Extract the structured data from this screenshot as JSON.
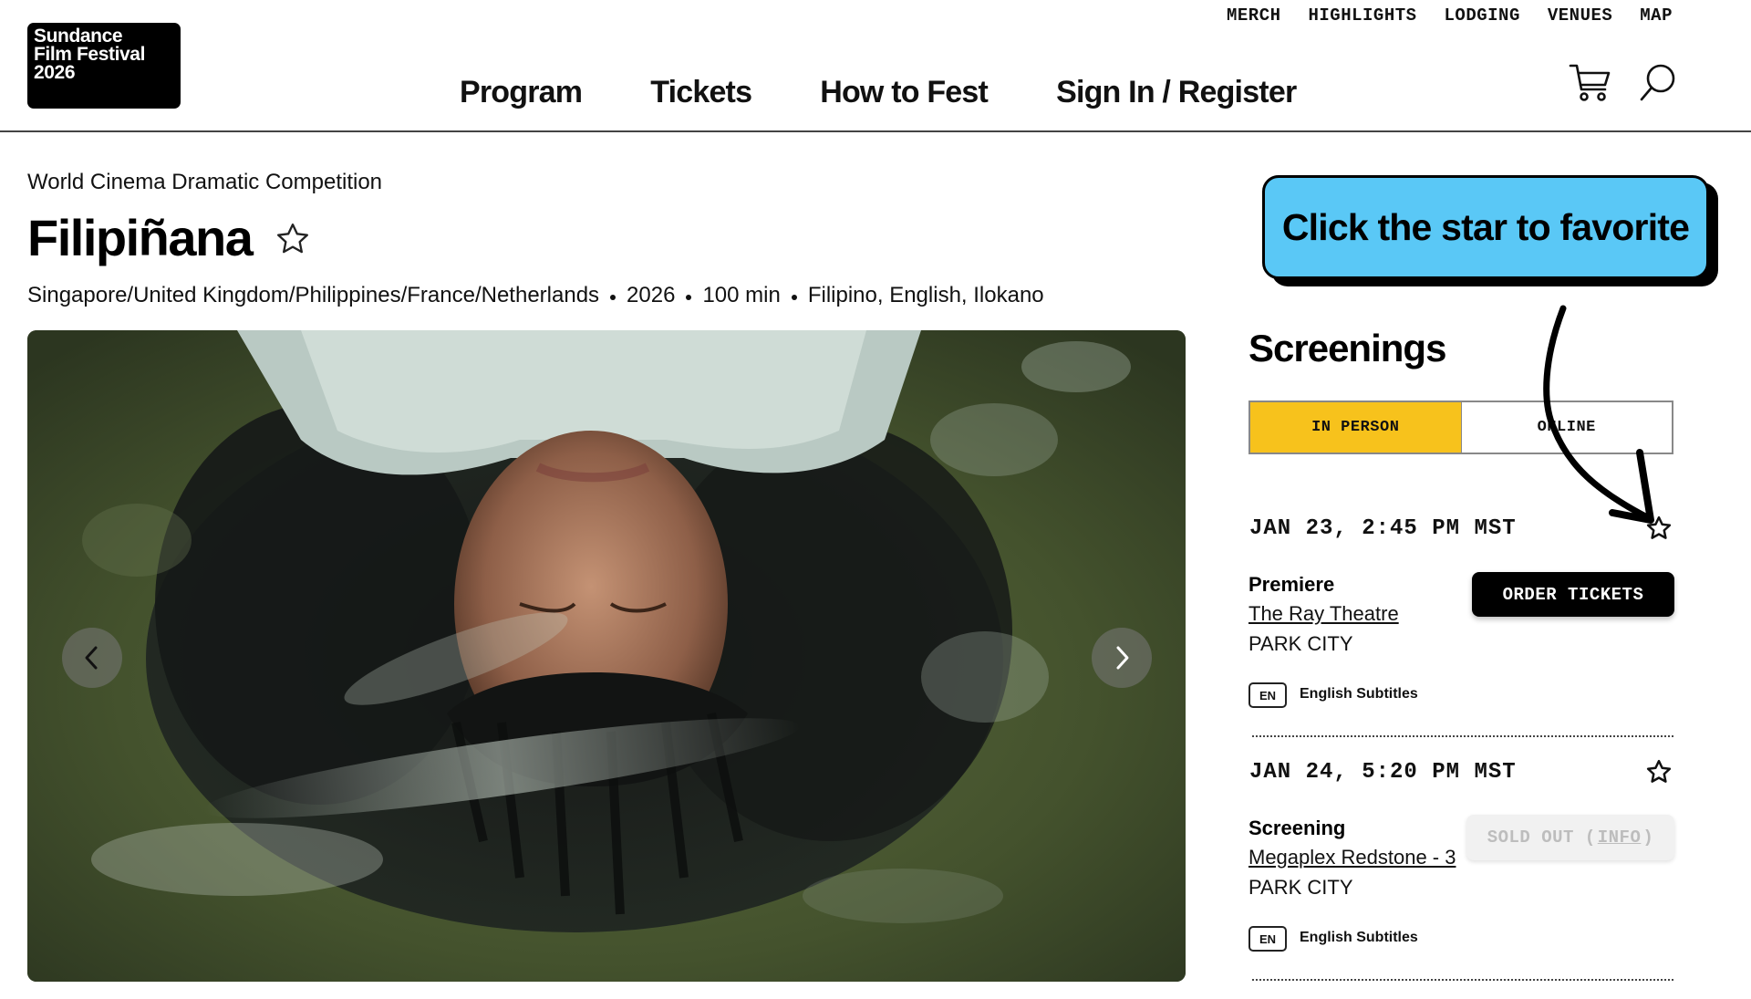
{
  "header": {
    "logo_lines": [
      "Sundance",
      "Film Festival",
      "2026"
    ],
    "utility_nav": [
      "MERCH",
      "HIGHLIGHTS",
      "LODGING",
      "VENUES",
      "MAP"
    ],
    "main_nav": [
      "Program",
      "Tickets",
      "How to Fest",
      "Sign In / Register"
    ]
  },
  "film": {
    "category": "World Cinema Dramatic Competition",
    "title": "Filipiñana",
    "countries": "Singapore/United Kingdom/Philippines/France/Netherlands",
    "year": "2026",
    "runtime": "100 min",
    "languages": "Filipino, English, Ilokano"
  },
  "callout": {
    "text": "Click the star to favorite",
    "color": "#5ac8f6"
  },
  "screenings": {
    "heading": "Screenings",
    "tabs": [
      {
        "label": "IN PERSON",
        "active": true
      },
      {
        "label": "ONLINE",
        "active": false
      }
    ],
    "items": [
      {
        "datetime": "JAN 23, 2:45 PM MST",
        "type": "Premiere",
        "venue": "The Ray Theatre",
        "city": "PARK CITY",
        "lang_code": "EN",
        "subtitles": "English Subtitles",
        "action": "ORDER TICKETS"
      },
      {
        "datetime": "JAN 24, 5:20 PM MST",
        "type": "Screening",
        "venue": "Megaplex Redstone - 3",
        "city": "PARK CITY",
        "lang_code": "EN",
        "subtitles": "English Subtitles",
        "action_prefix": "SOLD OUT (",
        "action_link": "INFO",
        "action_suffix": ")"
      }
    ]
  },
  "colors": {
    "accent_yellow": "#f7c21c",
    "callout_blue": "#5ac8f6"
  },
  "icons": [
    "cart-icon",
    "search-icon",
    "star-icon",
    "chevron-left-icon",
    "chevron-right-icon"
  ]
}
